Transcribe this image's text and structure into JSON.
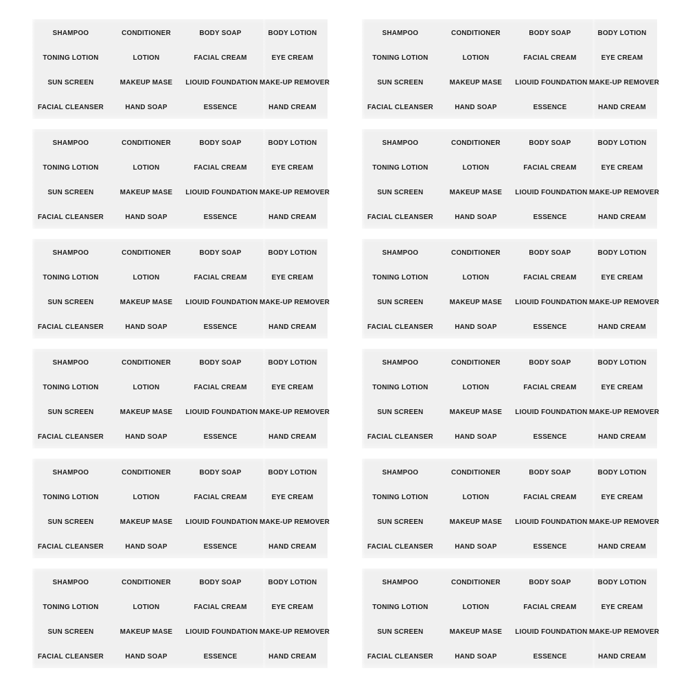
{
  "page": {
    "background_color": "#ffffff",
    "sheet_background_color": "#f0f0f0",
    "text_color": "#1c1c1c",
    "sheet_columns": 2,
    "sheet_rows": 6,
    "total_sheets": 12
  },
  "label_sheet": {
    "columns": 4,
    "rows": 4,
    "grid": [
      [
        "SHAMPOO",
        "CONDITIONER",
        "BODY SOAP",
        "BODY LOTION"
      ],
      [
        "TONING LOTION",
        "LOTION",
        "FACIAL CREAM",
        "EYE CREAM"
      ],
      [
        "SUN SCREEN",
        "MAKEUP MASE",
        "LIOUID FOUNDATION",
        "MAKE-UP REMOVER"
      ],
      [
        "FACIAL CLEANSER",
        "HAND SOAP",
        "ESSENCE",
        "HAND CREAM"
      ]
    ]
  }
}
